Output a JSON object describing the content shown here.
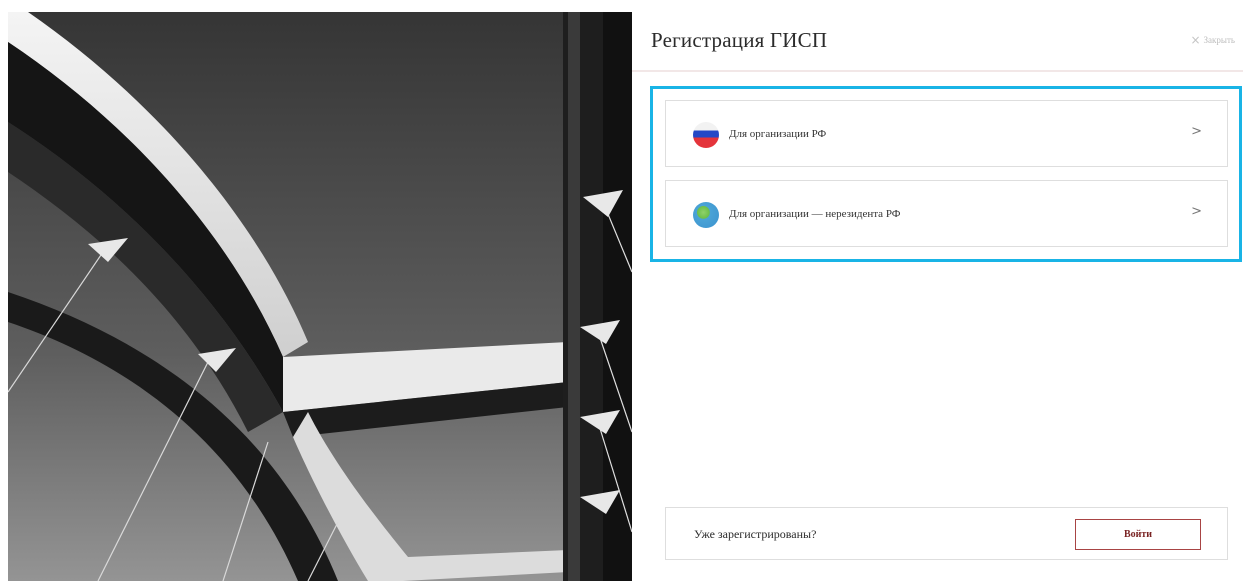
{
  "panel": {
    "title": "Регистрация ГИСП",
    "close_label": "Закрыть",
    "close_icon": "×"
  },
  "options": [
    {
      "label": "Для организации РФ",
      "icon": "russia-flag-icon",
      "chevron": ">"
    },
    {
      "label": "Для организации — нерезидента РФ",
      "icon": "globe-icon",
      "chevron": ">"
    }
  ],
  "login": {
    "prompt": "Уже зарегистрированы?",
    "button_label": "Войти"
  },
  "colors": {
    "highlight": "#19b4e6",
    "login_button_border": "#a84444",
    "login_button_text": "#7a2424"
  }
}
